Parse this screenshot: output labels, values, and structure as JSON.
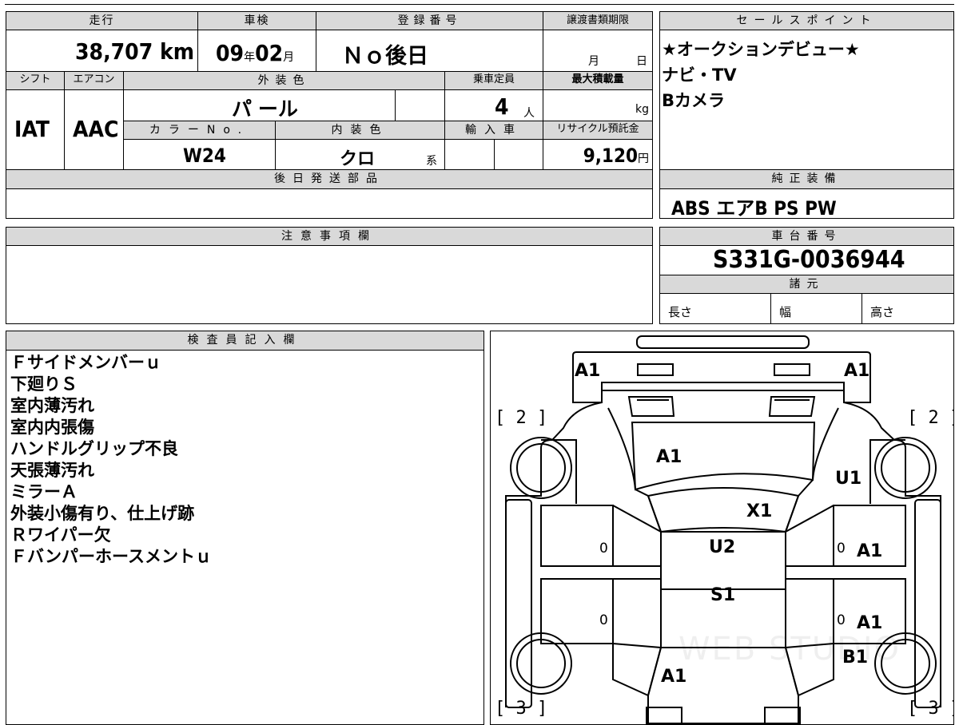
{
  "top_info": {
    "mileage": {
      "label": "走行",
      "value": "38,707 km"
    },
    "inspection": {
      "label": "車検",
      "year": "09",
      "year_unit": "年",
      "month": "02",
      "month_unit": "月"
    },
    "registration": {
      "label": "登録番号",
      "value": "Ｎｏ後日"
    },
    "transfer_deadline": {
      "label": "譲渡書類期限",
      "month_unit": "月",
      "day_unit": "日"
    },
    "shift": {
      "label": "シフト",
      "value": "IAT"
    },
    "aircon": {
      "label": "エアコン",
      "value": "AAC"
    },
    "exterior_color": {
      "label": "外装色",
      "value": "パ ール"
    },
    "capacity": {
      "label": "乗車定員",
      "value": "4",
      "unit": "人"
    },
    "max_load": {
      "label": "最大積載量",
      "unit": "kg"
    },
    "color_no": {
      "label": "カラーNo.",
      "value": "W24"
    },
    "interior_color": {
      "label": "内装色",
      "value": "クロ",
      "suffix": "系"
    },
    "import": {
      "label": "輸入車"
    },
    "recycle_fee": {
      "label": "リサイクル預託金",
      "value": "9,120",
      "unit": "円"
    },
    "later_parts": {
      "label": "後日発送部品"
    }
  },
  "sales_points": {
    "label": "セールスポイント",
    "lines": [
      "★オークションデビュー★",
      "ナビ・TV",
      "Bカメラ"
    ]
  },
  "genuine_equipment": {
    "label": "純正装備",
    "value": "ABS エアB PS PW"
  },
  "caution": {
    "label": "注意事項欄"
  },
  "chassis": {
    "label": "車台番号",
    "value": "S331G-0036944"
  },
  "specs": {
    "label": "諸元",
    "length": "長さ",
    "width": "幅",
    "height": "高さ"
  },
  "inspector": {
    "label": "検査員記入欄",
    "notes": [
      "Ｆサイドメンバーｕ",
      "下廻りＳ",
      "室内薄汚れ",
      "室内内張傷",
      "ハンドルグリップ不良",
      "天張薄汚れ",
      "ミラーＡ",
      "外装小傷有り、仕上げ跡",
      "Ｒワイパー欠",
      "Ｆバンパーホースメントｕ"
    ]
  },
  "diagram": {
    "marks": {
      "front_left": "A1",
      "front_right": "A1",
      "hood": "A1",
      "right_fender": "U1",
      "windshield": "X1",
      "roof_front": "U2",
      "roof_rear": "S1",
      "right_front_door": "A1",
      "right_rear_door": "A1",
      "right_quarter": "B1",
      "rear": "A1"
    },
    "corners": {
      "front_left": "[ 2 ]",
      "front_right": "[ 2 ]",
      "rear_left": "[ 3 ]",
      "rear_right": "[ 3 ]"
    },
    "zeros": {
      "lf": "0",
      "lr": "0",
      "rf": "0",
      "rr": "0"
    }
  },
  "watermark": "WEB STUDIO"
}
